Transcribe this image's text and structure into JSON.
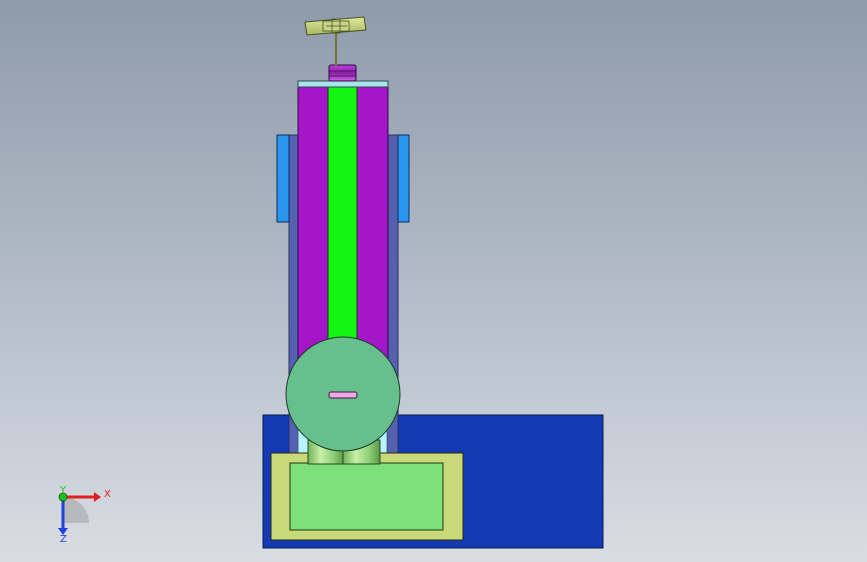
{
  "axis_triad": {
    "x_label": "X",
    "y_label": "Y",
    "z_label": "Z"
  },
  "colors": {
    "background_top": "#8e9bab",
    "background_bottom": "#d9dde3",
    "base_plate": "#1339b3",
    "frame_tan": "#c9d878",
    "block_green": "#7ee07a",
    "column_purple": "#a616c9",
    "column_core": "#14f514",
    "side_blue": "#2a96f0",
    "disc": "#66bf8c",
    "axis_x": "#e02020",
    "axis_y": "#20c020",
    "axis_z": "#2040e0"
  },
  "icons": {
    "axis_triad": "axis-triad-icon",
    "rotor": "rotor-blade-icon"
  }
}
